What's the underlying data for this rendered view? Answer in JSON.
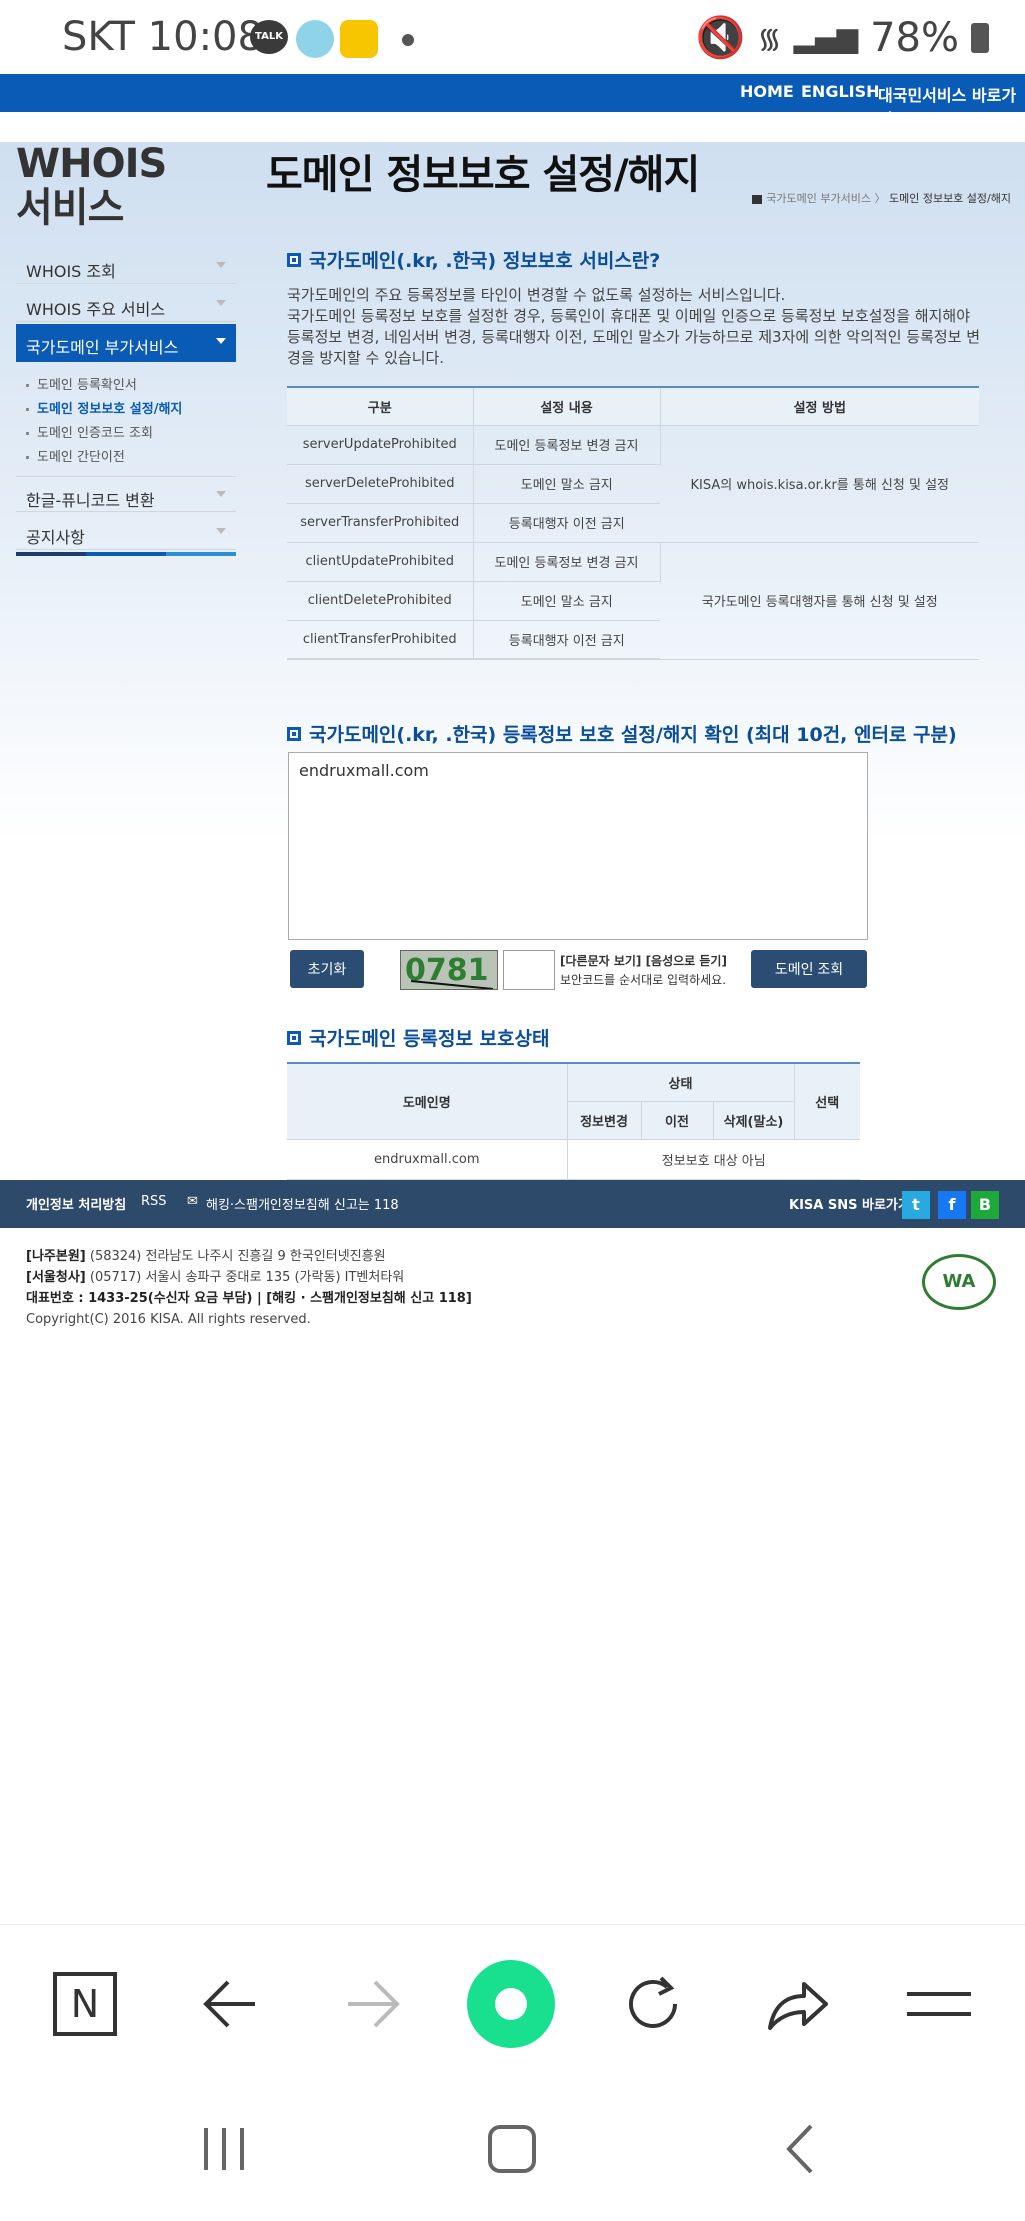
{
  "status_bar": {
    "carrier_time": "SKT 10:08",
    "talk_label": "TALK",
    "battery": "78%"
  },
  "top_nav": {
    "home": "HOME",
    "english": "ENGLISH",
    "gov_link": "대국민서비스 바로가기"
  },
  "sidebar": {
    "heading_line1": "WHOIS",
    "heading_line2": "서비스",
    "items": [
      {
        "label": "WHOIS 조회"
      },
      {
        "label": "WHOIS 주요 서비스"
      },
      {
        "label": "국가도메인 부가서비스"
      },
      {
        "label": "한글-퓨니코드 변환"
      },
      {
        "label": "공지사항"
      }
    ],
    "sub_items": [
      {
        "label": "도메인 등록확인서"
      },
      {
        "label": "도메인 정보보호 설정/해지"
      },
      {
        "label": "도메인 인증코드 조회"
      },
      {
        "label": "도메인 간단이전"
      }
    ]
  },
  "page": {
    "title": "도메인 정보보호 설정/해지",
    "breadcrumb_parent": "국가도메인 부가서비스",
    "breadcrumb_current": "도메인 정보보호 설정/해지"
  },
  "section1": {
    "heading": "국가도메인(.kr, .한국) 정보보호 서비스란?",
    "desc_line1": "국가도메인의 주요 등록정보를 타인이 변경할 수 없도록 설정하는 서비스입니다.",
    "desc_line2": "국가도메인 등록정보 보호를 설정한 경우, 등록인이 휴대폰 및 이메일 인증으로 등록정보 보호설정을 해지해야 등록정보 변경, 네임서버 변경, 등록대행자 이전, 도메인 말소가 가능하므로 제3자에 의한 악의적인 등록정보 변경을 방지할 수 있습니다.",
    "table": {
      "headers": [
        "구분",
        "설정 내용",
        "설정 방법"
      ],
      "rows": [
        {
          "type": "serverUpdateProhibited",
          "content": "도메인 등록정보 변경 금지"
        },
        {
          "type": "serverDeleteProhibited",
          "content": "도메인 말소 금지"
        },
        {
          "type": "serverTransferProhibited",
          "content": "등록대행자 이전 금지"
        },
        {
          "type": "clientUpdateProhibited",
          "content": "도메인 등록정보 변경 금지"
        },
        {
          "type": "clientDeleteProhibited",
          "content": "도메인 말소 금지"
        },
        {
          "type": "clientTransferProhibited",
          "content": "등록대행자 이전 금지"
        }
      ],
      "method_server": "KISA의 whois.kisa.or.kr를 통해 신청 및 설정",
      "method_client": "국가도메인 등록대행자를 통해 신청 및 설정"
    }
  },
  "section2": {
    "heading": "국가도메인(.kr, .한국) 등록정보 보호 설정/해지 확인 (최대 10건, 엔터로 구분)",
    "textarea_value": "endruxmall.com",
    "reset_button": "초기화",
    "captcha_text": "0781",
    "captcha_link": "[다른문자 보기] [음성으로 듣기]",
    "captcha_hint": "보안코드를 순서대로 입력하세요.",
    "lookup_button": "도메인 조회"
  },
  "section3": {
    "heading": "국가도메인 등록정보 보호상태",
    "headers": {
      "domain": "도메인명",
      "status": "상태",
      "info_change": "정보변경",
      "transfer": "이전",
      "delete": "삭제(말소)",
      "select": "선택"
    },
    "row": {
      "domain": "endruxmall.com",
      "status": "정보보호 대상 아님"
    }
  },
  "footer": {
    "privacy": "개인정보 처리방침",
    "rss": "RSS",
    "report": "해킹·스팸개인정보침해 신고는 118",
    "sns_label": "KISA SNS 바로가기",
    "naju_label": "[나주본원]",
    "naju_addr": "(58324) 전라남도 나주시 진흥길 9 한국인터넷진흥원",
    "seoul_label": "[서울청사]",
    "seoul_addr": "(05717) 서울시 송파구 중대로 135 (가락동) IT벤처타워",
    "phone": "대표번호 : 1433-25(수신자 요금 부담) | [해킹 · 스팸개인정보침해 신고 118]",
    "copyright": "Copyright(C) 2016 KISA. All rights reserved.",
    "wa_mark": "WA"
  },
  "colors": {
    "primary": "#0a5bb5",
    "dark_blue": "#2e4a6b",
    "accent_green": "#19e08f"
  }
}
